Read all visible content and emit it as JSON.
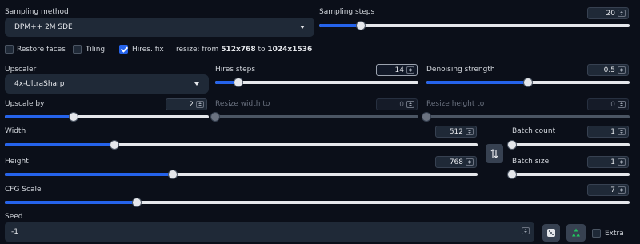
{
  "sampling_method": {
    "label": "Sampling method",
    "value": "DPM++ 2M SDE"
  },
  "sampling_steps": {
    "label": "Sampling steps",
    "value": "20"
  },
  "checkboxes": {
    "restore_faces": "Restore faces",
    "tiling": "Tiling",
    "hires_fix": "Hires. fix"
  },
  "resize_info": {
    "prefix": "resize: from ",
    "from": "512x768",
    "mid": " to ",
    "to": "1024x1536"
  },
  "upscaler": {
    "label": "Upscaler",
    "value": "4x-UltraSharp"
  },
  "hires_steps": {
    "label": "Hires steps",
    "value": "14"
  },
  "denoising": {
    "label": "Denoising strength",
    "value": "0.5"
  },
  "upscale_by": {
    "label": "Upscale by",
    "value": "2"
  },
  "resize_width": {
    "label": "Resize width to",
    "value": "0"
  },
  "resize_height": {
    "label": "Resize height to",
    "value": "0"
  },
  "width": {
    "label": "Width",
    "value": "512"
  },
  "height": {
    "label": "Height",
    "value": "768"
  },
  "batch_count": {
    "label": "Batch count",
    "value": "1"
  },
  "batch_size": {
    "label": "Batch size",
    "value": "1"
  },
  "cfg_scale": {
    "label": "CFG Scale",
    "value": "7"
  },
  "seed": {
    "label": "Seed",
    "value": "-1"
  },
  "extra": {
    "label": "Extra"
  },
  "icons": {
    "swap": "swap-arrows-icon",
    "dice": "dice-icon",
    "recycle": "recycle-icon"
  },
  "slider_levels": {
    "sampling_steps": 0.133,
    "hires_steps": 0.115,
    "denoising": 0.5,
    "upscale_by": 0.338,
    "resize_width": 0,
    "resize_height": 0,
    "width": 0.232,
    "height": 0.355,
    "batch_count": 0,
    "batch_size": 0,
    "cfg_scale": 0.211
  },
  "colors": {
    "accent": "#2563eb",
    "background": "#0b0f19",
    "panel": "#1f2937"
  }
}
